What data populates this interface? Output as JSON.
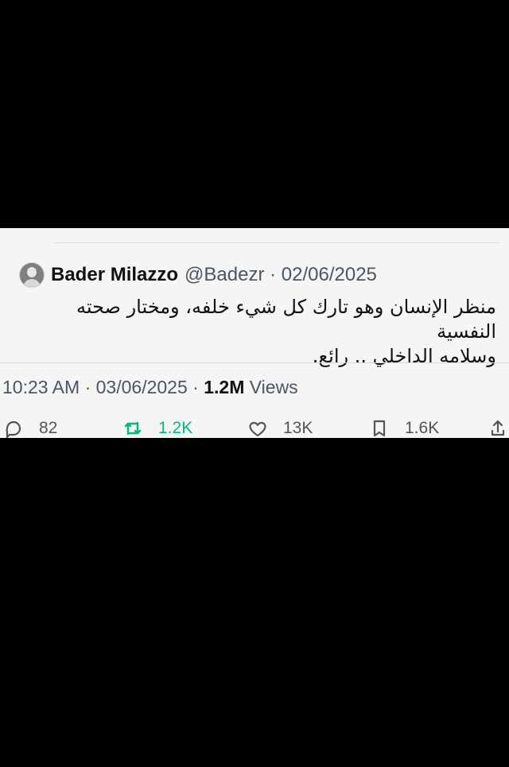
{
  "tweet": {
    "author": {
      "name": "Bader Milazzo",
      "handle": "@Badezr",
      "date": "02/06/2025"
    },
    "separator": "·",
    "text_line_1": "منظر الإنسان وهو تارك كل شيء خلفه، ومختار صحته النفسية",
    "text_line_2": "وسلامه الداخلي .. رائع.",
    "time": "10:23 AM",
    "posted_date": "03/06/2025",
    "views_count": "1.2M",
    "views_label": "Views"
  },
  "actions": [
    {
      "name": "reply",
      "icon": "comment-icon",
      "count": "82"
    },
    {
      "name": "retweet",
      "icon": "retweet-icon",
      "count": "1.2K",
      "color": "#00ba7c"
    },
    {
      "name": "like",
      "icon": "heart-icon",
      "count": "13K"
    },
    {
      "name": "bookmark",
      "icon": "bookmark-icon",
      "count": "1.6K"
    },
    {
      "name": "share",
      "icon": "share-icon",
      "count": ""
    }
  ],
  "colors": {
    "background": "#000000",
    "card": "#f5f5f4",
    "text": "#111111",
    "muted": "#4b5563",
    "retweet_accent": "#00ba7c"
  }
}
